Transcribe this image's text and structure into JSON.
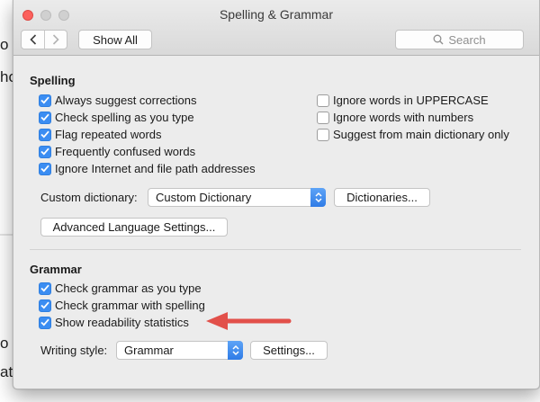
{
  "window": {
    "title": "Spelling & Grammar",
    "toolbar": {
      "show_all_label": "Show All",
      "search_placeholder": "Search"
    }
  },
  "spelling": {
    "heading": "Spelling",
    "left_options": [
      {
        "label": "Always suggest corrections",
        "checked": true
      },
      {
        "label": "Check spelling as you type",
        "checked": true
      },
      {
        "label": "Flag repeated words",
        "checked": true
      },
      {
        "label": "Frequently confused words",
        "checked": true
      },
      {
        "label": "Ignore Internet and file path addresses",
        "checked": true
      }
    ],
    "right_options": [
      {
        "label": "Ignore words in UPPERCASE",
        "checked": false
      },
      {
        "label": "Ignore words with numbers",
        "checked": false
      },
      {
        "label": "Suggest from main dictionary only",
        "checked": false
      }
    ],
    "custom_dictionary_label": "Custom dictionary:",
    "custom_dictionary_value": "Custom Dictionary",
    "dictionaries_button": "Dictionaries...",
    "advanced_button": "Advanced Language Settings..."
  },
  "grammar": {
    "heading": "Grammar",
    "options": [
      {
        "label": "Check grammar as you type",
        "checked": true
      },
      {
        "label": "Check grammar with spelling",
        "checked": true
      },
      {
        "label": "Show readability statistics",
        "checked": true
      }
    ],
    "writing_style_label": "Writing style:",
    "writing_style_value": "Grammar",
    "settings_button": "Settings..."
  },
  "background": {
    "fragments": [
      "o",
      "ho",
      "o",
      "at"
    ]
  },
  "colors": {
    "accent": "#3b8df2",
    "annotation_arrow": "#e2504a",
    "close": "#fc615d"
  },
  "icons": {
    "back": "chevron-left-icon",
    "forward": "chevron-right-icon",
    "search": "magnifier-icon",
    "popup": "updown-chevrons-icon"
  }
}
